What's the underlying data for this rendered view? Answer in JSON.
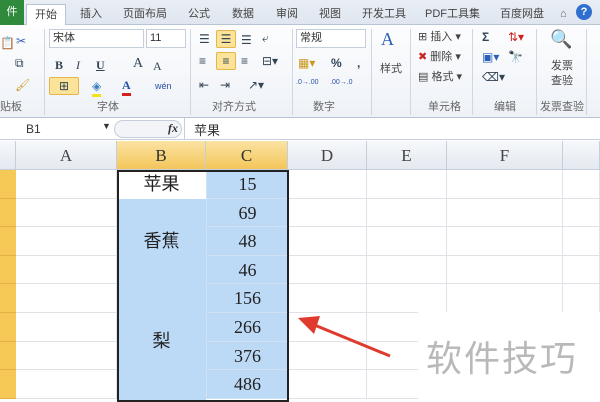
{
  "tabs": {
    "file": "件",
    "items": [
      "开始",
      "插入",
      "页面布局",
      "公式",
      "数据",
      "审阅",
      "视图",
      "开发工具",
      "PDF工具集",
      "百度网盘"
    ]
  },
  "ribbon": {
    "clipboard": {
      "label": "贴板"
    },
    "font": {
      "name": "宋体",
      "size": "11",
      "bold": "B",
      "italic": "I",
      "underline": "U",
      "grow": "A",
      "shrink": "A",
      "font_color": "A",
      "phonetic": "wén",
      "label": "字体"
    },
    "alignment": {
      "label": "对齐方式"
    },
    "number": {
      "format": "常规",
      "percent": "%",
      "comma": ",",
      "inc": ".0→.00",
      "dec": ".00→.0",
      "label": "数字"
    },
    "styles": {
      "button": "样式"
    },
    "cells": {
      "insert": "插入",
      "delete": "删除",
      "format": "格式",
      "label": "单元格"
    },
    "editing": {
      "sum": "Σ",
      "label": "编辑"
    },
    "invoice": {
      "button": "发票查验",
      "label": "发票查验"
    }
  },
  "formula_bar": {
    "name_box": "B1",
    "fx": "fx",
    "content": "苹果"
  },
  "columns": [
    "A",
    "B",
    "C",
    "D",
    "E",
    "F"
  ],
  "cells": {
    "b_groups": [
      "苹果",
      "香蕉",
      "梨"
    ],
    "c_values": [
      "15",
      "69",
      "48",
      "46",
      "156",
      "266",
      "376",
      "486"
    ]
  },
  "watermark": "软件技巧",
  "colors": {
    "selection": "#bcdaf6",
    "header_selected": "#f3c65a",
    "arrow": "#e03a2f"
  }
}
